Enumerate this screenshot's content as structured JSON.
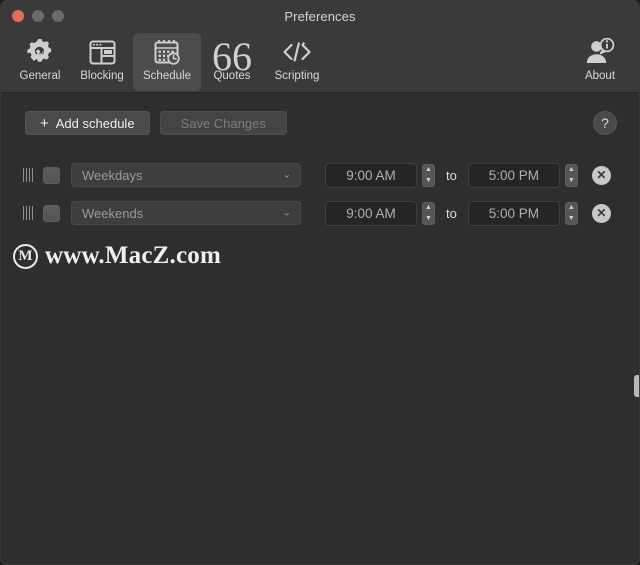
{
  "window": {
    "title": "Preferences",
    "controls": {
      "close": "close-button",
      "minimize": "minimize-button",
      "zoom": "zoom-button"
    }
  },
  "toolbar": {
    "items": [
      {
        "label": "General",
        "icon": "gear-wrench-icon",
        "selected": false
      },
      {
        "label": "Blocking",
        "icon": "browser-window-icon",
        "selected": false
      },
      {
        "label": "Schedule",
        "icon": "calendar-clock-icon",
        "selected": true
      },
      {
        "label": "Quotes",
        "icon": "quotation-mark-icon",
        "selected": false
      },
      {
        "label": "Scripting",
        "icon": "code-brackets-icon",
        "selected": false
      }
    ],
    "about": {
      "label": "About",
      "icon": "person-info-icon"
    }
  },
  "actions": {
    "add_schedule_label": "Add schedule",
    "add_schedule_plus": "+",
    "save_changes_label": "Save Changes",
    "save_changes_disabled": true,
    "help_label": "?"
  },
  "schedule": {
    "columns": [
      "handle",
      "enabled",
      "days",
      "start",
      "to",
      "end",
      "delete"
    ],
    "to_label": "to",
    "delete_glyph": "✕",
    "chevron": "⌄",
    "rows": [
      {
        "enabled": false,
        "days": "Weekdays",
        "start_time": "9:00 AM",
        "end_time": "5:00 PM"
      },
      {
        "enabled": false,
        "days": "Weekends",
        "start_time": "9:00 AM",
        "end_time": "5:00 PM"
      }
    ]
  },
  "watermark": {
    "logo_letter": "M",
    "text": "www.MacZ.com"
  },
  "colors": {
    "close_red": "#e8695f",
    "titlebar": "#3a3a3a",
    "content_bg": "#2e2e2e",
    "selected_tab": "#4c4c4c"
  }
}
